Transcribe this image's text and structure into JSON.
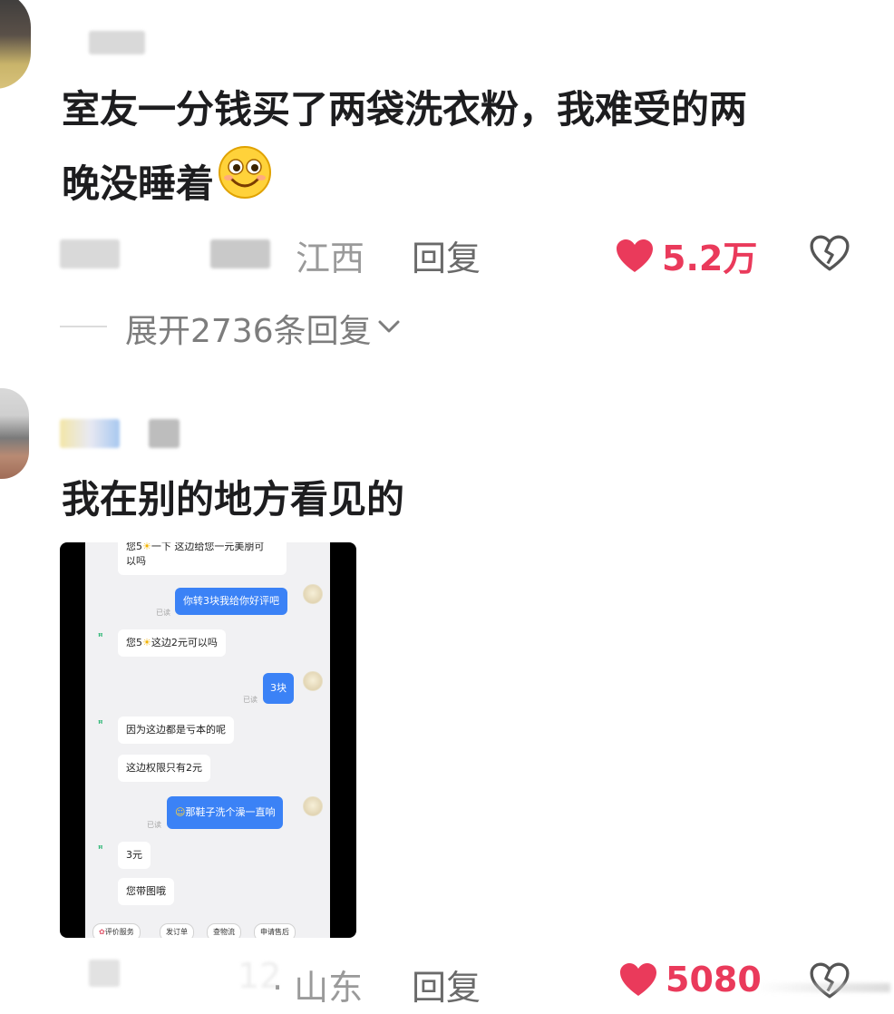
{
  "comment1": {
    "text_line1": "室友一分钱买了两袋洗衣粉，我难受的两",
    "text_line2": "晚没睡着",
    "location": "江西",
    "reply_label": "回复",
    "likes": "5.2万",
    "expand_label": "展开2736条回复",
    "like_icon": "heart-icon",
    "dislike_icon": "broken-heart-icon",
    "emoji_icon": "smiley-emoji-icon"
  },
  "comment2": {
    "text": "我在别的地方看见的",
    "location": "山东",
    "reply_label": "回复",
    "likes": "5080",
    "time_fragment": "12"
  },
  "chat": {
    "msg0": "您5",
    "msg0_tail": "一下 这边给您一元美朋可",
    "msg0_line2": "以吗",
    "msg1": "你转3块我给你好评吧",
    "msg2": "您5",
    "msg2_tail": "这边2元可以吗",
    "msg3": "3块",
    "msg4": "因为这边都是亏本的呢",
    "msg5": "这边权限只有2元",
    "msg6": "那鞋子洗个澡一直响",
    "msg7": "3元",
    "msg8": "您带图哦",
    "read_label": "已读",
    "chips": [
      "评价服务",
      "发订单",
      "查物流",
      "申请售后"
    ]
  },
  "colors": {
    "accent_like": "#ea3a5b",
    "bubble_blue": "#3b82f6"
  }
}
